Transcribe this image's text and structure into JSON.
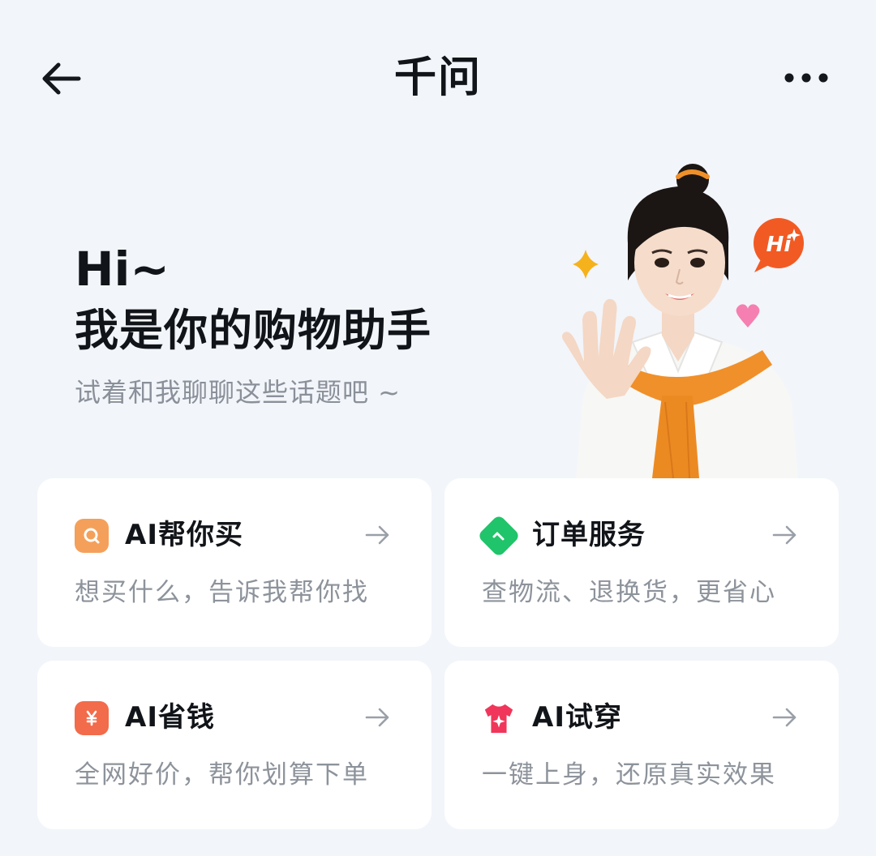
{
  "header": {
    "title": "千问",
    "back_icon": "arrow-left-icon",
    "more_icon": "more-horizontal-icon"
  },
  "hero": {
    "greeting": "Hi~",
    "title": "我是你的购物助手",
    "subtitle": "试着和我聊聊这些话题吧 ~",
    "badge_text": "Hi"
  },
  "cards": [
    {
      "title": "AI帮你买",
      "subtitle": "想买什么，告诉我帮你找",
      "icon": "search-icon",
      "color": "#f5a05a"
    },
    {
      "title": "订单服务",
      "subtitle": "查物流、退换货，更省心",
      "icon": "order-box-icon",
      "color": "#20c46a"
    },
    {
      "title": "AI省钱",
      "subtitle": "全网好价，帮你划算下单",
      "icon": "yen-coupon-icon",
      "color": "#f26b4a"
    },
    {
      "title": "AI试穿",
      "subtitle": "一键上身，还原真实效果",
      "icon": "tshirt-icon",
      "color": "#f0365a"
    }
  ],
  "colors": {
    "background": "#f2f5fa",
    "card": "#ffffff",
    "subtitle_text": "#8d939b",
    "scarf_orange": "#f0902a"
  }
}
